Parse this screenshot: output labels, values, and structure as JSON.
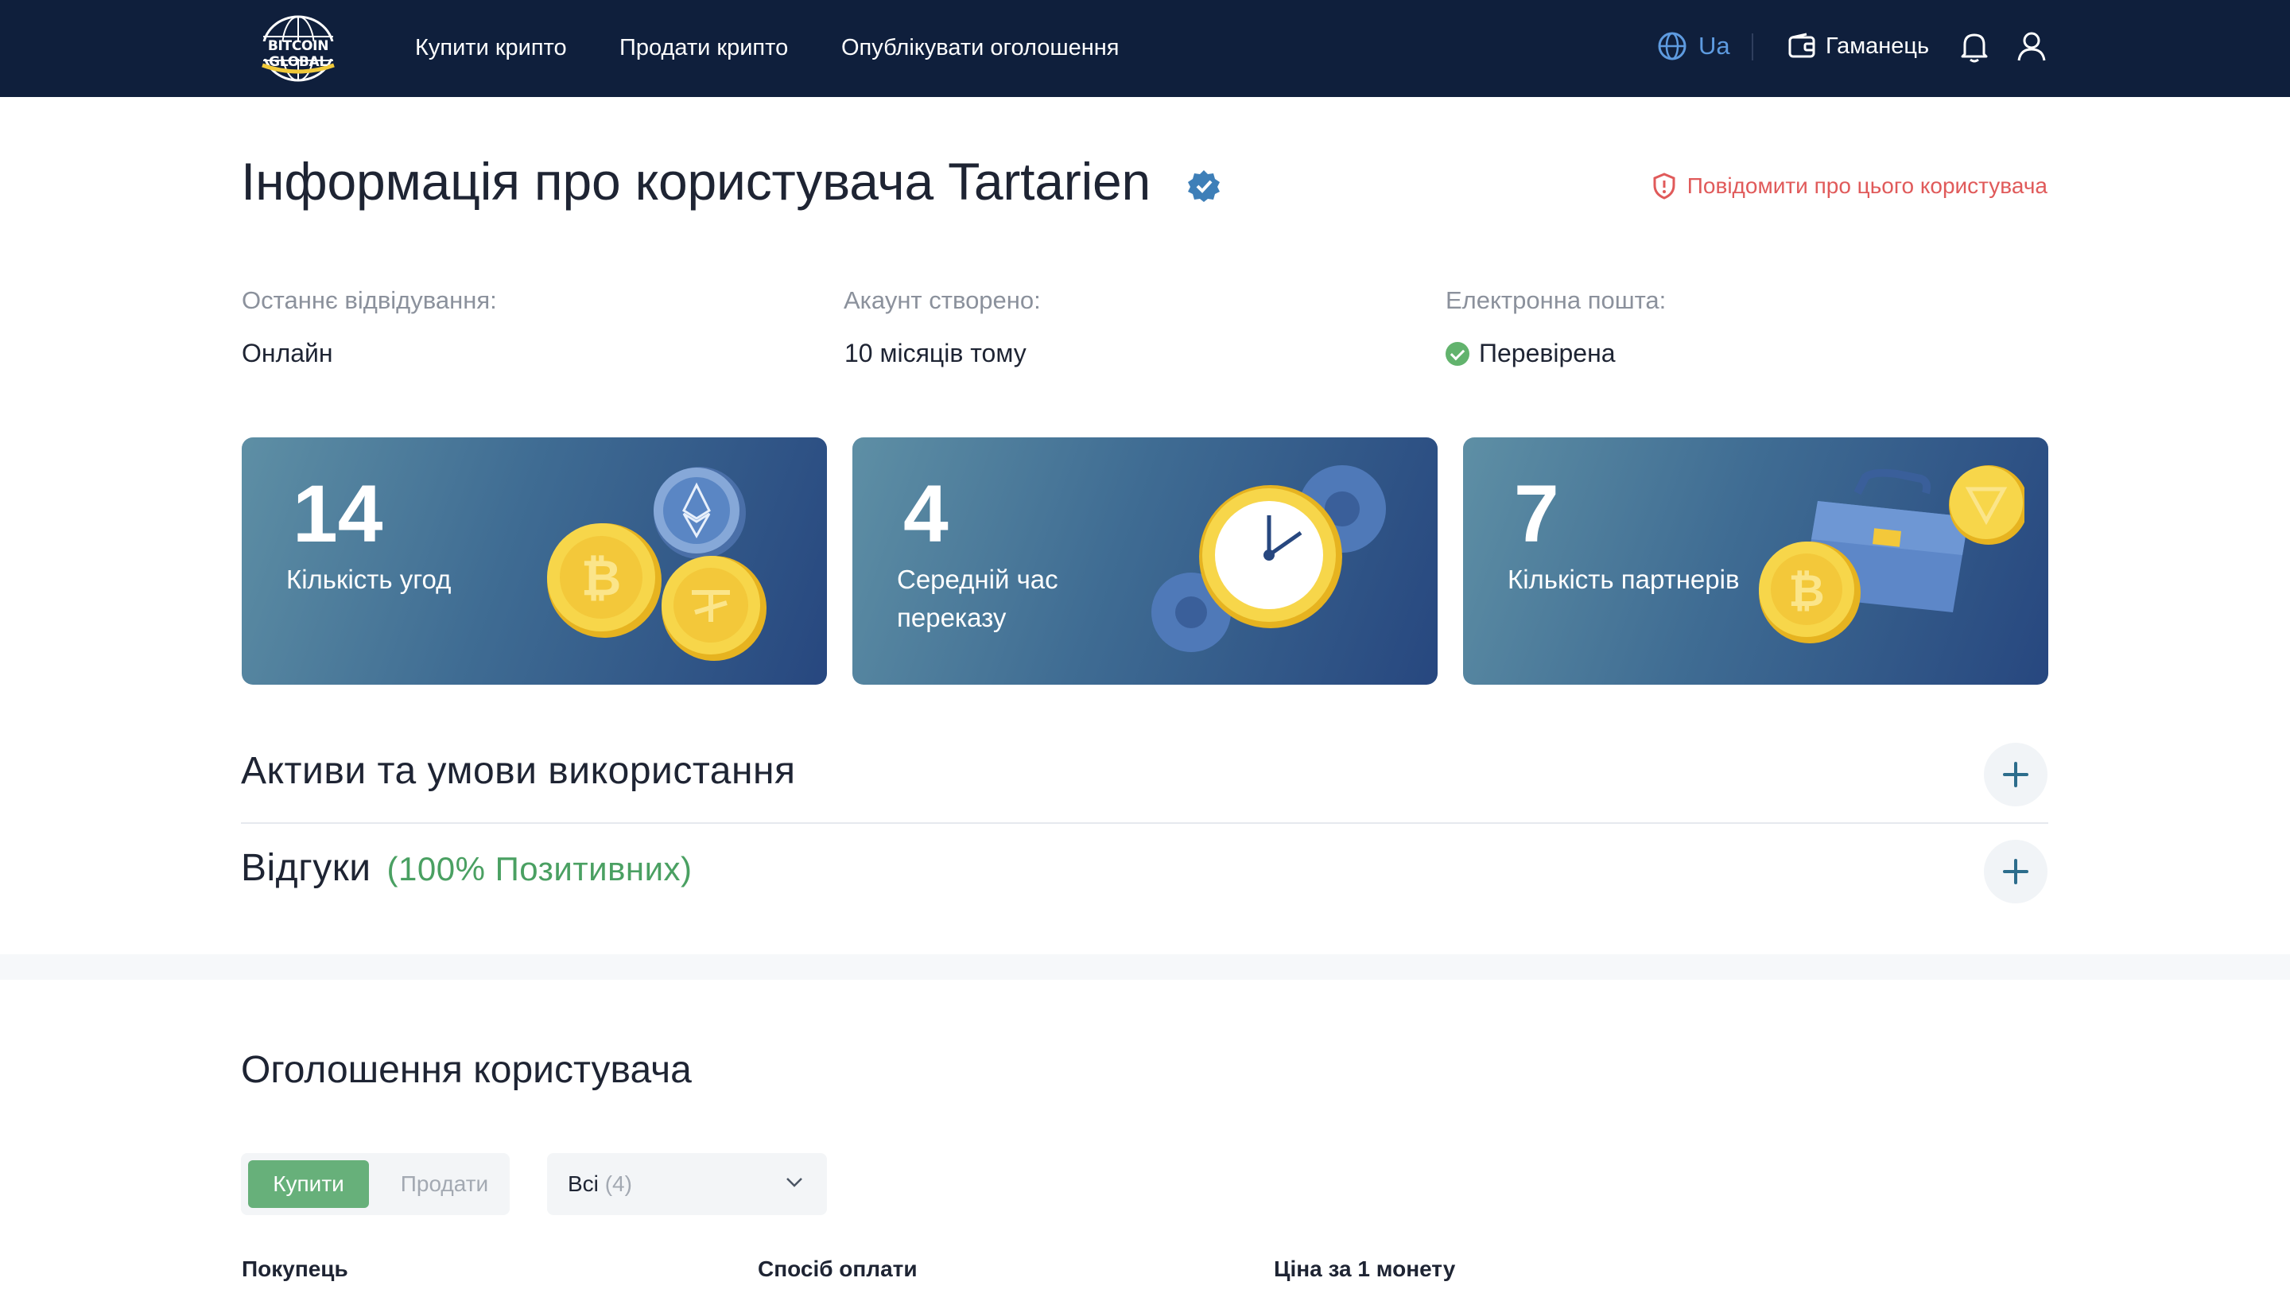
{
  "header": {
    "logo_text": "BITCOIN GLOBAL",
    "nav": [
      "Купити крипто",
      "Продати крипто",
      "Опублікувати оголошення"
    ],
    "language": "Ua",
    "wallet_label": "Гаманець",
    "icons": [
      "globe-icon",
      "wallet-icon",
      "bell-icon",
      "user-icon"
    ]
  },
  "profile": {
    "title": "Інформація про користувача Tartarien",
    "report_label": "Повідомити про цього користувача",
    "info": [
      {
        "label": "Останнє відвідування:",
        "value": "Онлайн"
      },
      {
        "label": "Акаунт створено:",
        "value": "10 місяців тому"
      },
      {
        "label": "Електронна пошта:",
        "value": "Перевірена"
      }
    ]
  },
  "stats": [
    {
      "value": "14",
      "label": "Кількість угод"
    },
    {
      "value": "4",
      "label": "Середній час переказу"
    },
    {
      "value": "7",
      "label": "Кількість партнерів"
    }
  ],
  "accordion": {
    "assets_title": "Активи та умови використання",
    "reviews_title": "Відгуки",
    "reviews_sub": "(100% Позитивних)"
  },
  "listings": {
    "title": "Оголошення користувача",
    "tab_buy": "Купити",
    "tab_sell": "Продати",
    "filter_label": "Всі",
    "filter_count": "(4)",
    "columns": [
      "Покупець",
      "Спосіб оплати",
      "Ціна за 1 монету"
    ]
  },
  "colors": {
    "header_bg": "#0f1f3c",
    "accent_blue": "#5e9be0",
    "report_red": "#e05a5a",
    "positive_green": "#4aa062",
    "active_tab": "#67b07a"
  }
}
